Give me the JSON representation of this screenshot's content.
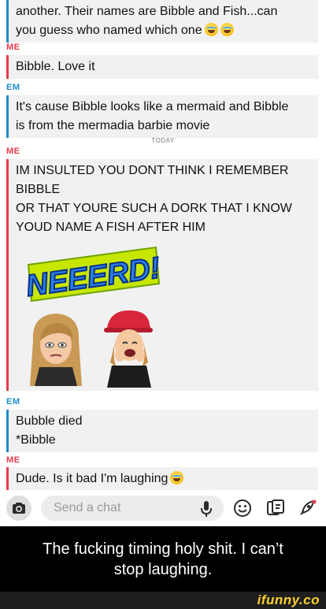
{
  "messages": [
    {
      "lines": [
        "another. Their names are Bibble and Fish...can",
        "you guess who named which one"
      ]
    },
    {
      "sender": "ME",
      "lines": [
        "Bibble. Love it"
      ]
    },
    {
      "sender": "EM",
      "lines": [
        "It's cause Bibble looks like a mermaid and Bibble",
        "is from the mermadia barbie movie"
      ]
    },
    {
      "sender": "ME",
      "lines": [
        "IM INSULTED YOU DONT THINK I REMEMBER",
        "BIBBLE",
        "OR THAT YOURE SUCH A DORK THAT I KNOW",
        "YOUD NAME A FISH AFTER HIM"
      ]
    },
    {
      "sender": "EM",
      "lines": [
        "Bubble died",
        "*Bibble"
      ]
    },
    {
      "sender": "ME",
      "lines": [
        "Dude. Is it bad I'm laughing"
      ]
    }
  ],
  "date_divider": "TODAY",
  "sticker_text": "NEEERD!",
  "composer": {
    "placeholder": "Send a chat"
  },
  "icons": {
    "camera": "camera-icon",
    "microphone": "microphone-icon",
    "emoji": "smiley-icon",
    "stickers": "sticker-icon",
    "games": "rocket-icon"
  },
  "caption": {
    "lines": [
      "The fucking timing holy shit. I can’t",
      "stop laughing."
    ]
  },
  "watermark": "ifunny.co",
  "colors": {
    "me": "#ea3a4b",
    "em": "#1e8cc9",
    "bubble": "#f1f1f1",
    "brand": "#ffcf2e"
  }
}
